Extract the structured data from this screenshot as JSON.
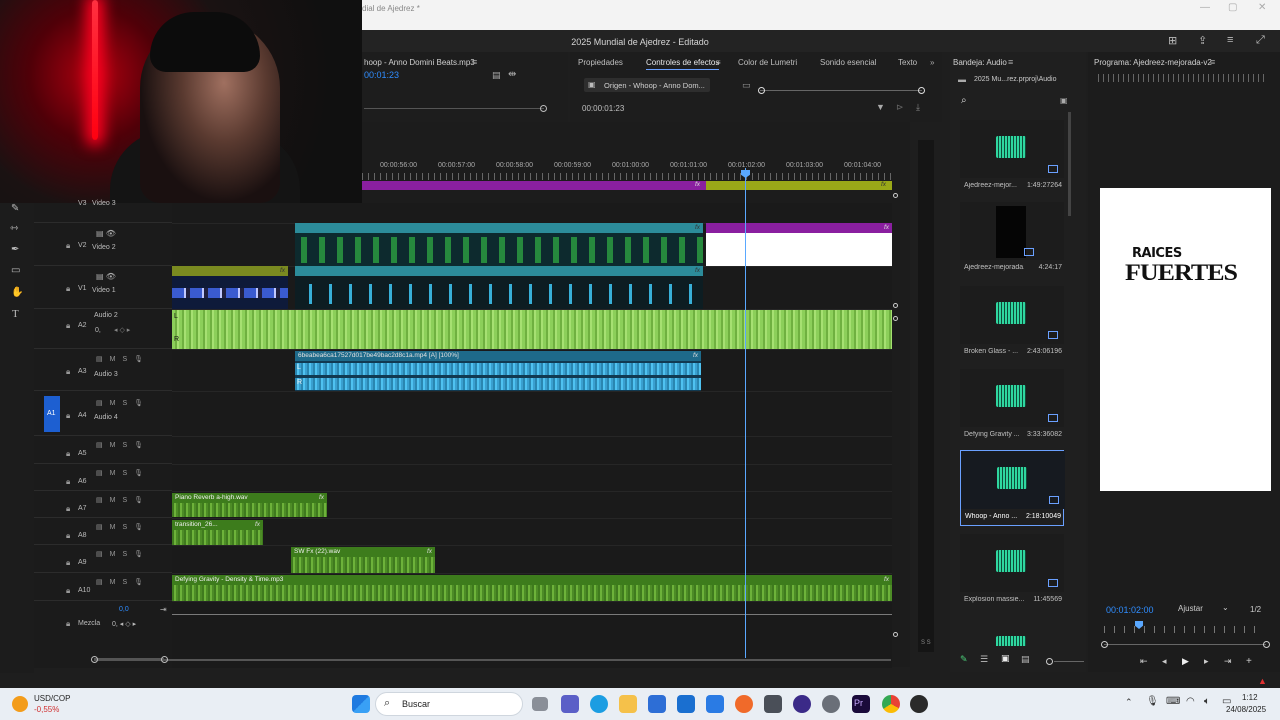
{
  "window": {
    "title_partial": "dial de Ajedrez *",
    "project_title": "2025 Mundial de Ajedrez",
    "project_state": "Editado"
  },
  "source_monitor": {
    "title": "hoop - Anno Domini Beats.mp3",
    "timecode": "00:01:23"
  },
  "effects_panel": {
    "tabs": [
      "Propiedades",
      "Controles de efectos",
      "Color de Lumetri",
      "Sonido esencial",
      "Texto"
    ],
    "active_tab": "Controles de efectos",
    "source_label": "Origen - Whoop - Anno Dom...",
    "timecode": "00:00:01:23"
  },
  "timeline": {
    "ruler_labels": [
      "00:00:56:00",
      "00:00:57:00",
      "00:00:58:00",
      "00:00:59:00",
      "00:01:00:00",
      "00:01:01:00",
      "00:01:02:00",
      "00:01:03:00",
      "00:01:04:00"
    ],
    "tracks": [
      {
        "id": "V3",
        "name": "Video 3"
      },
      {
        "id": "V2",
        "name": "Video 2"
      },
      {
        "id": "V1",
        "name": "Video 1"
      },
      {
        "id": "A2",
        "name": "Audio 2"
      },
      {
        "id": "A3",
        "name": "Audio 3"
      },
      {
        "id": "A4",
        "name": "Audio 4"
      },
      {
        "id": "A5",
        "name": ""
      },
      {
        "id": "A6",
        "name": ""
      },
      {
        "id": "A7",
        "name": ""
      },
      {
        "id": "A8",
        "name": ""
      },
      {
        "id": "A9",
        "name": ""
      },
      {
        "id": "A10",
        "name": ""
      }
    ],
    "source_patch": "A1",
    "mix_label": "Mezcla",
    "mix_value": "0,0",
    "a2_value": "0,",
    "clips": {
      "a3_clip": "6beabea6ca17527d017be49bac2d8c1a.mp4 [A] [100%]",
      "a7_clip": "Piano Reverb a-high.wav",
      "a8_clip": "transition_26...",
      "a9_clip": "SW Fx (22).wav",
      "a10_clip": "Defying Gravity - Density & Time.mp3"
    },
    "fx_label": "fx",
    "channel_l": "L",
    "channel_r": "R"
  },
  "bin": {
    "title": "Bandeja: Audio",
    "project_file": "2025 Mu...rez.prproj\\Audio",
    "items": [
      {
        "name": "Ajedreez-mejor...",
        "duration": "1:49:27264"
      },
      {
        "name": "Ajedreez-mejorada...",
        "duration": "4:24:17"
      },
      {
        "name": "Broken Glass - ...",
        "duration": "2:43:06196"
      },
      {
        "name": "Defying Gravity ...",
        "duration": "3:33:36082"
      },
      {
        "name": "Whoop - Anno ...",
        "duration": "2:18:10049"
      },
      {
        "name": "Explosion massie...",
        "duration": "11:45569"
      }
    ]
  },
  "program_monitor": {
    "title": "Programa: Ajedreez-mejorada-v2",
    "timecode": "00:01:02:00",
    "fit": "Ajustar",
    "resolution": "1/2",
    "title_line1": "RAICES",
    "title_line2": "FUERTES"
  },
  "meter": {
    "label": "S S"
  },
  "taskbar": {
    "ticker": "USD/COP",
    "ticker_change": "-0,55%",
    "search_placeholder": "Buscar",
    "time": "1:12",
    "date": "24/08/2025"
  }
}
